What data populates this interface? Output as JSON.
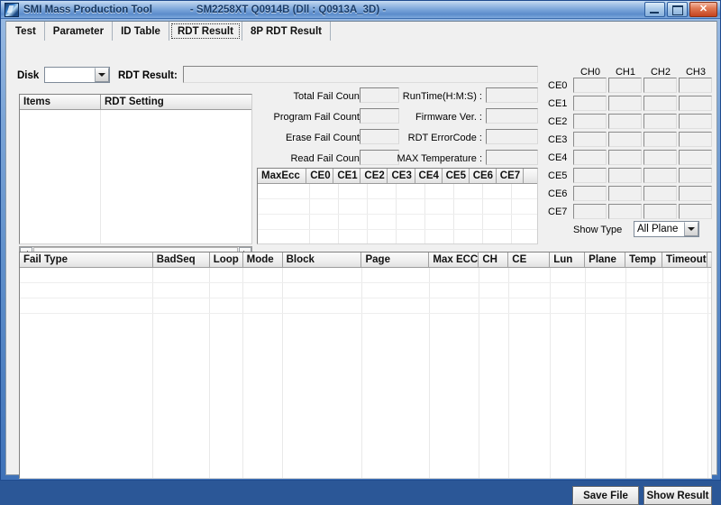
{
  "window": {
    "title": "SMI Mass Production Tool",
    "subtitle": "- SM2258XT    Q0914B    (Dll : Q0913A_3D) -",
    "icon": "app-icon",
    "buttons": {
      "minimize": "minimize-icon",
      "maximize": "maximize-icon",
      "close": "✕"
    }
  },
  "tabs": [
    {
      "label": "Test",
      "selected": false
    },
    {
      "label": "Parameter",
      "selected": false
    },
    {
      "label": "ID Table",
      "selected": false
    },
    {
      "label": "RDT Result",
      "selected": true
    },
    {
      "label": "8P RDT Result",
      "selected": false
    }
  ],
  "toolbar": {
    "disk_label": "Disk",
    "disk_value": "",
    "rdt_result_label": "RDT Result:",
    "rdt_result_value": ""
  },
  "items_grid": {
    "columns": [
      "Items",
      "RDT Setting"
    ],
    "rows": []
  },
  "counters": {
    "left": [
      {
        "label": "Total Fail Count:",
        "value": ""
      },
      {
        "label": "Program Fail Count :",
        "value": ""
      },
      {
        "label": "Erase Fail Count :",
        "value": ""
      },
      {
        "label": "Read Fail Count:",
        "value": ""
      }
    ],
    "right": [
      {
        "label": "RunTime(H:M:S) :",
        "value": ""
      },
      {
        "label": "Firmware Ver. :",
        "value": ""
      },
      {
        "label": "RDT ErrorCode :",
        "value": ""
      },
      {
        "label": "MAX Temperature :",
        "value": ""
      }
    ]
  },
  "maxecc_grid": {
    "columns": [
      "MaxEcc",
      "CE0",
      "CE1",
      "CE2",
      "CE3",
      "CE4",
      "CE5",
      "CE6",
      "CE7",
      ""
    ],
    "rows": []
  },
  "ce_matrix": {
    "channels": [
      "CH0",
      "CH1",
      "CH2",
      "CH3"
    ],
    "rows": [
      "CE0",
      "CE1",
      "CE2",
      "CE3",
      "CE4",
      "CE5",
      "CE6",
      "CE7"
    ],
    "values": [
      [
        "",
        "",
        "",
        ""
      ],
      [
        "",
        "",
        "",
        ""
      ],
      [
        "",
        "",
        "",
        ""
      ],
      [
        "",
        "",
        "",
        ""
      ],
      [
        "",
        "",
        "",
        ""
      ],
      [
        "",
        "",
        "",
        ""
      ],
      [
        "",
        "",
        "",
        ""
      ],
      [
        "",
        "",
        "",
        ""
      ]
    ],
    "show_type_label": "Show Type",
    "show_type_value": "All Plane",
    "show_type_options": [
      "All Plane"
    ]
  },
  "fail_table": {
    "columns": [
      "Fail Type",
      "BadSeq",
      "Loop",
      "Mode",
      "Block",
      "Page",
      "Max ECC",
      "CH",
      "CE",
      "Lun",
      "Plane",
      "Temp",
      "Timeout",
      ""
    ],
    "rows": []
  },
  "footer": {
    "save_file": "Save File",
    "show_result": "Show Result"
  },
  "colors": {
    "frame": "#3f72b8",
    "client": "#f0f0f0",
    "field": "#f0f0f0",
    "grid_bg": "#ffffff",
    "text": "#000000"
  }
}
